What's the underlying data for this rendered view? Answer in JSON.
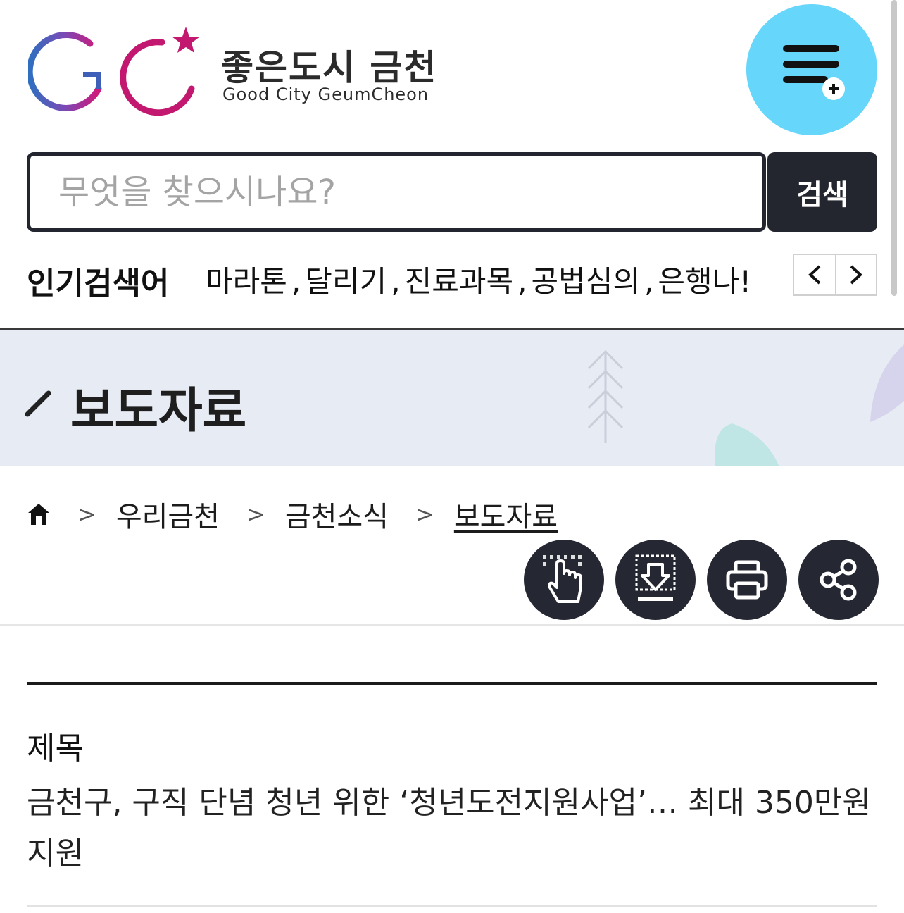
{
  "header": {
    "logo_title": "좋은도시 금천",
    "logo_subtitle": "Good City GeumCheon",
    "menu_icon": "menu-plus-icon",
    "colors": {
      "menu_button": "#66d6fa",
      "logo_blue": "#3a62b8",
      "logo_magenta": "#c2186f"
    }
  },
  "search": {
    "placeholder": "무엇을 찾으시나요?",
    "value": "",
    "button_label": "검색"
  },
  "popular": {
    "label": "인기검색어",
    "keywords": [
      "마라톤",
      "달리기",
      "진료과목",
      "공법심의",
      "은행나!"
    ],
    "prev_icon": "chevron-left-icon",
    "next_icon": "chevron-right-icon"
  },
  "banner": {
    "title": "보도자료",
    "background": "#e7ebf3"
  },
  "breadcrumb": {
    "home_icon": "home-icon",
    "items": [
      "우리금천",
      "금천소식",
      "보도자료"
    ],
    "separator": ">"
  },
  "tools": [
    {
      "icon": "touch-hand-icon",
      "label": ""
    },
    {
      "icon": "download-icon",
      "label": ""
    },
    {
      "icon": "print-icon",
      "label": ""
    },
    {
      "icon": "share-icon",
      "label": ""
    }
  ],
  "article": {
    "subject_label": "제목",
    "subject_text": "금천구, 구직 단념 청년 위한 ‘청년도전지원사업’… 최대 350만원 지원"
  }
}
